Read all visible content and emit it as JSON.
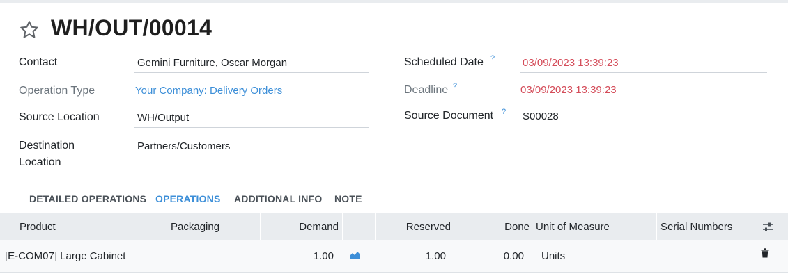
{
  "record": {
    "title": "WH/OUT/00014"
  },
  "form": {
    "contact_label": "Contact",
    "contact_value": "Gemini Furniture, Oscar Morgan",
    "operation_type_label": "Operation Type",
    "operation_type_value": "Your Company: Delivery Orders",
    "source_location_label": "Source Location",
    "source_location_value": "WH/Output",
    "destination_location_label_line1": "Destination",
    "destination_location_label_line2": "Location",
    "destination_location_value": "Partners/Customers",
    "scheduled_date_label": "Scheduled Date",
    "scheduled_date_value": "03/09/2023 13:39:23",
    "deadline_label": "Deadline",
    "deadline_value": "03/09/2023 13:39:23",
    "source_document_label": "Source Document",
    "source_document_value": "S00028",
    "help_mark": "?"
  },
  "tabs": [
    {
      "label": "DETAILED OPERATIONS"
    },
    {
      "label": "OPERATIONS"
    },
    {
      "label": "ADDITIONAL INFO"
    },
    {
      "label": "NOTE"
    }
  ],
  "table": {
    "columns": {
      "product": "Product",
      "packaging": "Packaging",
      "demand": "Demand",
      "reserved": "Reserved",
      "done": "Done",
      "uom": "Unit of Measure",
      "serials": "Serial Numbers"
    },
    "rows": [
      {
        "product": "[E-COM07] Large Cabinet",
        "packaging": "",
        "demand": "1.00",
        "reserved": "1.00",
        "done": "0.00",
        "uom": "Units",
        "serials": ""
      }
    ]
  },
  "icons": {
    "favorite": "star-outline-icon",
    "forecast": "area-chart-icon",
    "optional_columns": "sliders-icon",
    "delete": "trash-icon"
  },
  "colors": {
    "accent": "#3d8fd8",
    "deadline_red": "#d44c59",
    "header_bg": "#e9ecef"
  }
}
